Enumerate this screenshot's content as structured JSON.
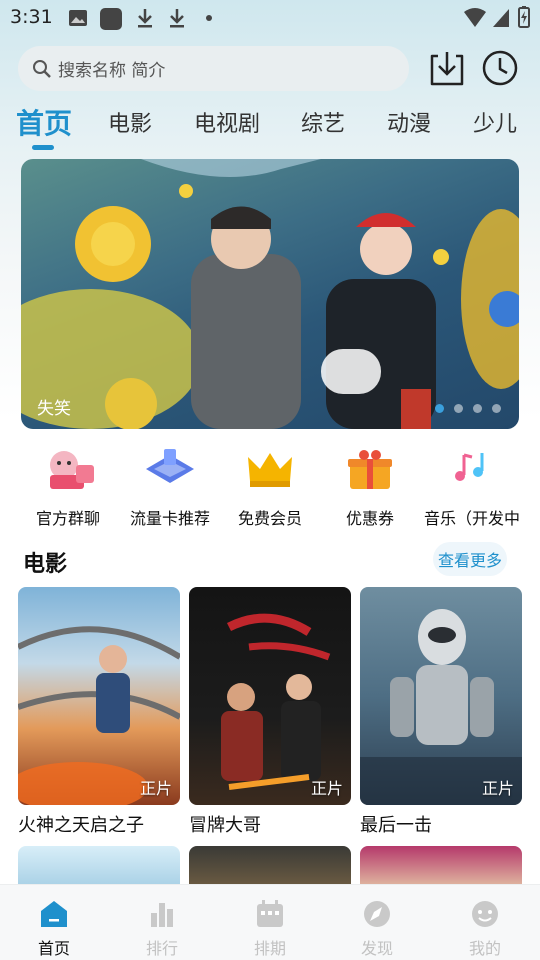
{
  "status_bar": {
    "time": "3:31"
  },
  "search": {
    "placeholder": "搜索名称 简介"
  },
  "tabs": [
    {
      "label": "首页",
      "active": true
    },
    {
      "label": "电影"
    },
    {
      "label": "电视剧"
    },
    {
      "label": "综艺"
    },
    {
      "label": "动漫"
    },
    {
      "label": "少儿"
    }
  ],
  "banner": {
    "title": "失笑",
    "dots": 4,
    "active_dot": 1
  },
  "quick_menu": [
    {
      "label": "官方群聊",
      "icon": "group-chat-icon"
    },
    {
      "label": "流量卡推荐",
      "icon": "data-card-icon"
    },
    {
      "label": "免费会员",
      "icon": "crown-icon"
    },
    {
      "label": "优惠券",
      "icon": "gift-icon"
    },
    {
      "label": "音乐（开发中",
      "icon": "music-note-icon"
    }
  ],
  "section": {
    "title": "电影",
    "more_label": "查看更多"
  },
  "movies": [
    {
      "title": "火神之天启之子",
      "badge": "正片"
    },
    {
      "title": "冒牌大哥",
      "badge": "正片"
    },
    {
      "title": "最后一击",
      "badge": "正片"
    }
  ],
  "bottom_nav": [
    {
      "label": "首页",
      "active": true
    },
    {
      "label": "排行"
    },
    {
      "label": "排期"
    },
    {
      "label": "发现"
    },
    {
      "label": "我的"
    }
  ],
  "colors": {
    "accent": "#1f90cc",
    "inactive": "#c2c2c2"
  }
}
